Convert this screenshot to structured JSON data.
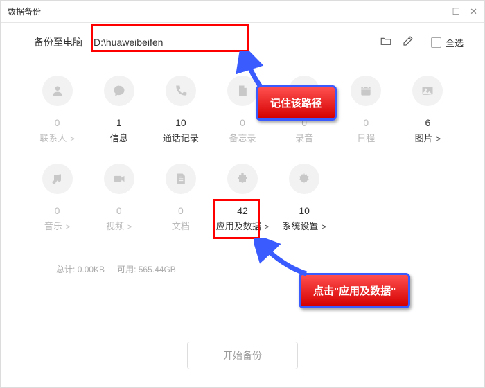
{
  "window": {
    "title": "数据备份"
  },
  "pathbar": {
    "label": "备份至电脑",
    "path_value": "D:\\huaweibeifen",
    "select_all": "全选"
  },
  "categories_row1": [
    {
      "key": "contacts",
      "count": "0",
      "label": "联系人",
      "chev": true,
      "dark": false,
      "icon": "person"
    },
    {
      "key": "messages",
      "count": "1",
      "label": "信息",
      "chev": false,
      "dark": true,
      "icon": "message"
    },
    {
      "key": "calllog",
      "count": "10",
      "label": "通话记录",
      "chev": false,
      "dark": true,
      "icon": "phone"
    },
    {
      "key": "memo",
      "count": "0",
      "label": "备忘录",
      "chev": false,
      "dark": false,
      "icon": "note"
    },
    {
      "key": "recording",
      "count": "0",
      "label": "录音",
      "chev": false,
      "dark": false,
      "icon": "mic"
    },
    {
      "key": "calendar",
      "count": "0",
      "label": "日程",
      "chev": false,
      "dark": false,
      "icon": "calendar"
    },
    {
      "key": "pictures",
      "count": "6",
      "label": "图片",
      "chev": true,
      "dark": true,
      "icon": "image"
    }
  ],
  "categories_row2": [
    {
      "key": "music",
      "count": "0",
      "label": "音乐",
      "chev": true,
      "dark": false,
      "icon": "music"
    },
    {
      "key": "video",
      "count": "0",
      "label": "视频",
      "chev": true,
      "dark": false,
      "icon": "video"
    },
    {
      "key": "document",
      "count": "0",
      "label": "文档",
      "chev": false,
      "dark": false,
      "icon": "doc"
    },
    {
      "key": "appdata",
      "count": "42",
      "label": "应用及数据",
      "chev": true,
      "dark": true,
      "icon": "puzzle"
    },
    {
      "key": "sysset",
      "count": "10",
      "label": "系统设置",
      "chev": true,
      "dark": true,
      "icon": "gear"
    }
  ],
  "summary": {
    "total_label": "总计:",
    "total_value": "0.00KB",
    "avail_label": "可用:",
    "avail_value": "565.44GB"
  },
  "start_button": "开始备份",
  "callouts": {
    "remember_path": "记住该路径",
    "click_appdata": "点击\"应用及数据\""
  }
}
